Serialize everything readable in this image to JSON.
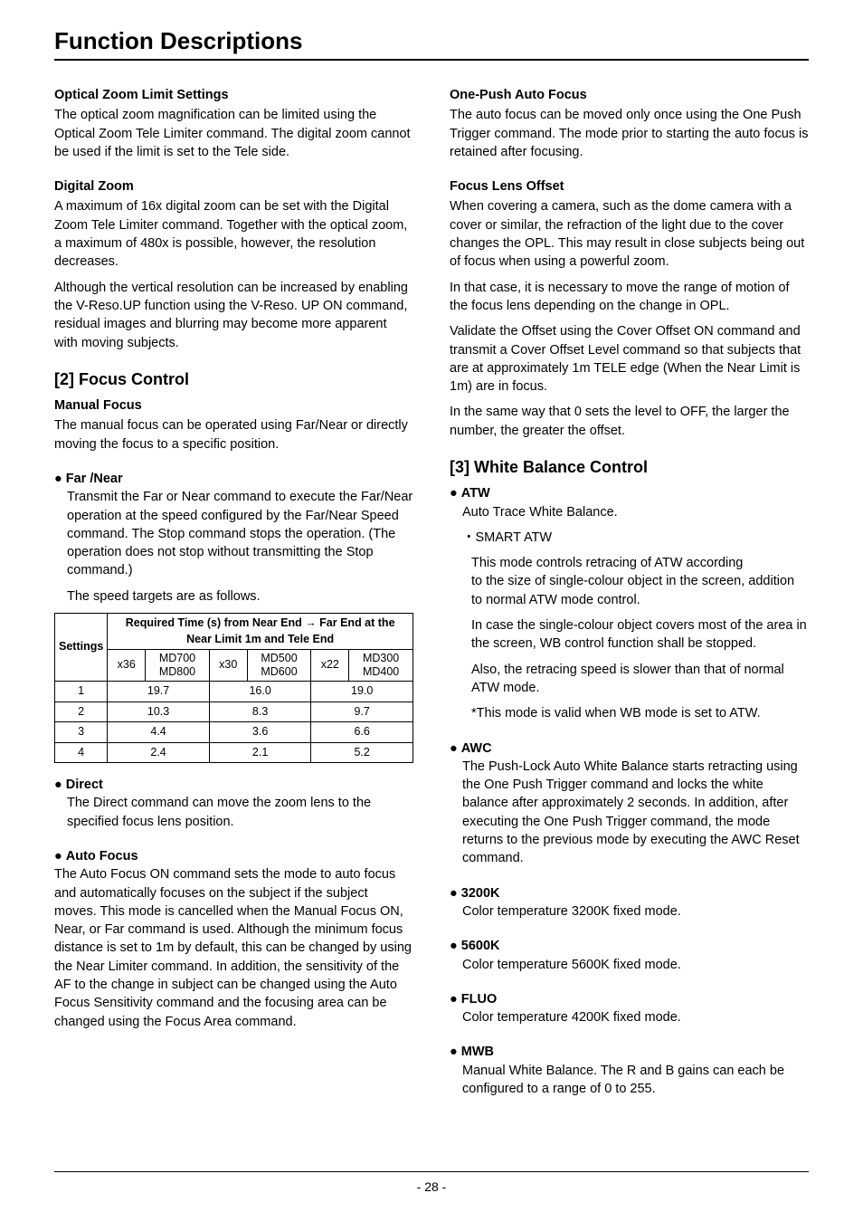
{
  "header": {
    "title": "Function Descriptions"
  },
  "left": {
    "optical": {
      "head": "Optical Zoom Limit Settings",
      "body": "The optical zoom magnification can be limited using the Optical Zoom Tele Limiter command. The digital zoom cannot be used if the limit is set to the Tele side."
    },
    "digital": {
      "head": "Digital Zoom",
      "body1": "A maximum of 16x digital zoom can be set with the Digital Zoom Tele Limiter command. Together with the optical zoom, a maximum of 480x is possible, however, the resolution decreases.",
      "body2": "Although the vertical resolution can be increased by enabling the V-Reso.UP function using the V-Reso. UP ON command, residual images and blurring may become more apparent with moving subjects."
    },
    "focus": {
      "section": "[2]  Focus Control",
      "manual": {
        "head": "Manual Focus",
        "body": "The manual focus can be operated using Far/Near or directly moving the focus to a specific position."
      },
      "farNear": {
        "head": "Far /Near",
        "body": "Transmit the Far or Near command to execute the Far/Near operation at the speed configured by the Far/Near Speed command. The Stop command stops the operation. (The operation does not stop without transmitting the Stop command.)",
        "tail": "The speed targets are as follows."
      },
      "table": {
        "settingsLabel": "Settings",
        "topHeader": "Required Time (s) from Near End → Far End at the Near Limit 1m and Tele End",
        "cols": [
          {
            "mult": "x36",
            "a": "MD700",
            "b": "MD800"
          },
          {
            "mult": "x30",
            "a": "MD500",
            "b": "MD600"
          },
          {
            "mult": "x22",
            "a": "MD300",
            "b": "MD400"
          }
        ],
        "rows": [
          {
            "s": "1",
            "v": [
              "19.7",
              "16.0",
              "19.0"
            ]
          },
          {
            "s": "2",
            "v": [
              "10.3",
              "8.3",
              "9.7"
            ]
          },
          {
            "s": "3",
            "v": [
              "4.4",
              "3.6",
              "6.6"
            ]
          },
          {
            "s": "4",
            "v": [
              "2.4",
              "2.1",
              "5.2"
            ]
          }
        ]
      },
      "direct": {
        "head": "Direct",
        "body": "The Direct command can move the zoom lens to the specified focus lens position."
      },
      "auto": {
        "head": "Auto Focus",
        "body": "The Auto Focus ON command sets the mode to auto focus and automatically focuses on the subject if the subject moves. This mode is cancelled when the Manual Focus ON, Near, or Far command is used. Although the minimum focus distance is set to 1m by default, this can be changed by using the Near Limiter command. In addition, the sensitivity of the AF to the change in subject can be changed using the Auto Focus Sensitivity command and the focusing area can be changed using the Focus Area command."
      }
    }
  },
  "right": {
    "onePush": {
      "head": "One-Push Auto Focus",
      "body": "The auto focus can be moved only once using the One Push Trigger command. The mode prior to starting the auto focus is retained after focusing."
    },
    "offset": {
      "head": "Focus Lens Offset",
      "body1": "When covering a camera, such as the dome camera with a cover or similar, the refraction of the light due to the cover changes the OPL. This may result in close subjects being out of focus when using a powerful zoom.",
      "body2": "In that case, it is necessary to move the range of motion of the focus lens depending on the change in OPL.",
      "body3": "Validate the Offset using the Cover Offset ON command and transmit a Cover Offset Level command so that subjects that are at approximately 1m TELE edge (When the Near Limit is 1m) are in focus.",
      "body4": "In the same way that 0 sets the level to OFF, the larger the number, the greater the offset."
    },
    "wb": {
      "section": "[3]  White Balance Control",
      "atw": {
        "head": "ATW",
        "line1": "Auto Trace White Balance.",
        "smart": "・SMART ATW",
        "smart1": "This mode controls retracing of ATW according",
        "smart2": " to the size of single-colour object in the screen, addition to normal ATW mode control.",
        "smart3": "In case the single-colour object covers most of the area in the screen, WB control function shall be stopped.",
        "smart4": "Also, the retracing speed is slower than that of normal ATW mode.",
        "smart5": "*This mode is valid when WB mode is set to ATW."
      },
      "awc": {
        "head": "AWC",
        "body": "The Push-Lock Auto White Balance starts retracting using the One Push Trigger command and locks the white balance after approximately 2 seconds. In addition, after executing the One Push Trigger command, the mode returns to the previous mode by executing the AWC Reset command."
      },
      "k3200": {
        "head": "3200K",
        "body": "Color temperature 3200K fixed mode."
      },
      "k5600": {
        "head": "5600K",
        "body": "Color temperature 5600K fixed mode."
      },
      "fluo": {
        "head": "FLUO",
        "body": "Color temperature 4200K fixed mode."
      },
      "mwb": {
        "head": "MWB",
        "body": "Manual White Balance. The R and B gains can each be configured to a range of 0 to 255."
      }
    }
  },
  "footer": {
    "page": "- 28 -"
  },
  "chart_data": {
    "type": "table",
    "title": "Required Time (s) from Near End → Far End at the Near Limit 1m and Tele End",
    "columns": [
      "Settings",
      "x36 MD700/MD800",
      "x30 MD500/MD600",
      "x22 MD300/MD400"
    ],
    "rows": [
      [
        1,
        19.7,
        16.0,
        19.0
      ],
      [
        2,
        10.3,
        8.3,
        9.7
      ],
      [
        3,
        4.4,
        3.6,
        6.6
      ],
      [
        4,
        2.4,
        2.1,
        5.2
      ]
    ]
  }
}
